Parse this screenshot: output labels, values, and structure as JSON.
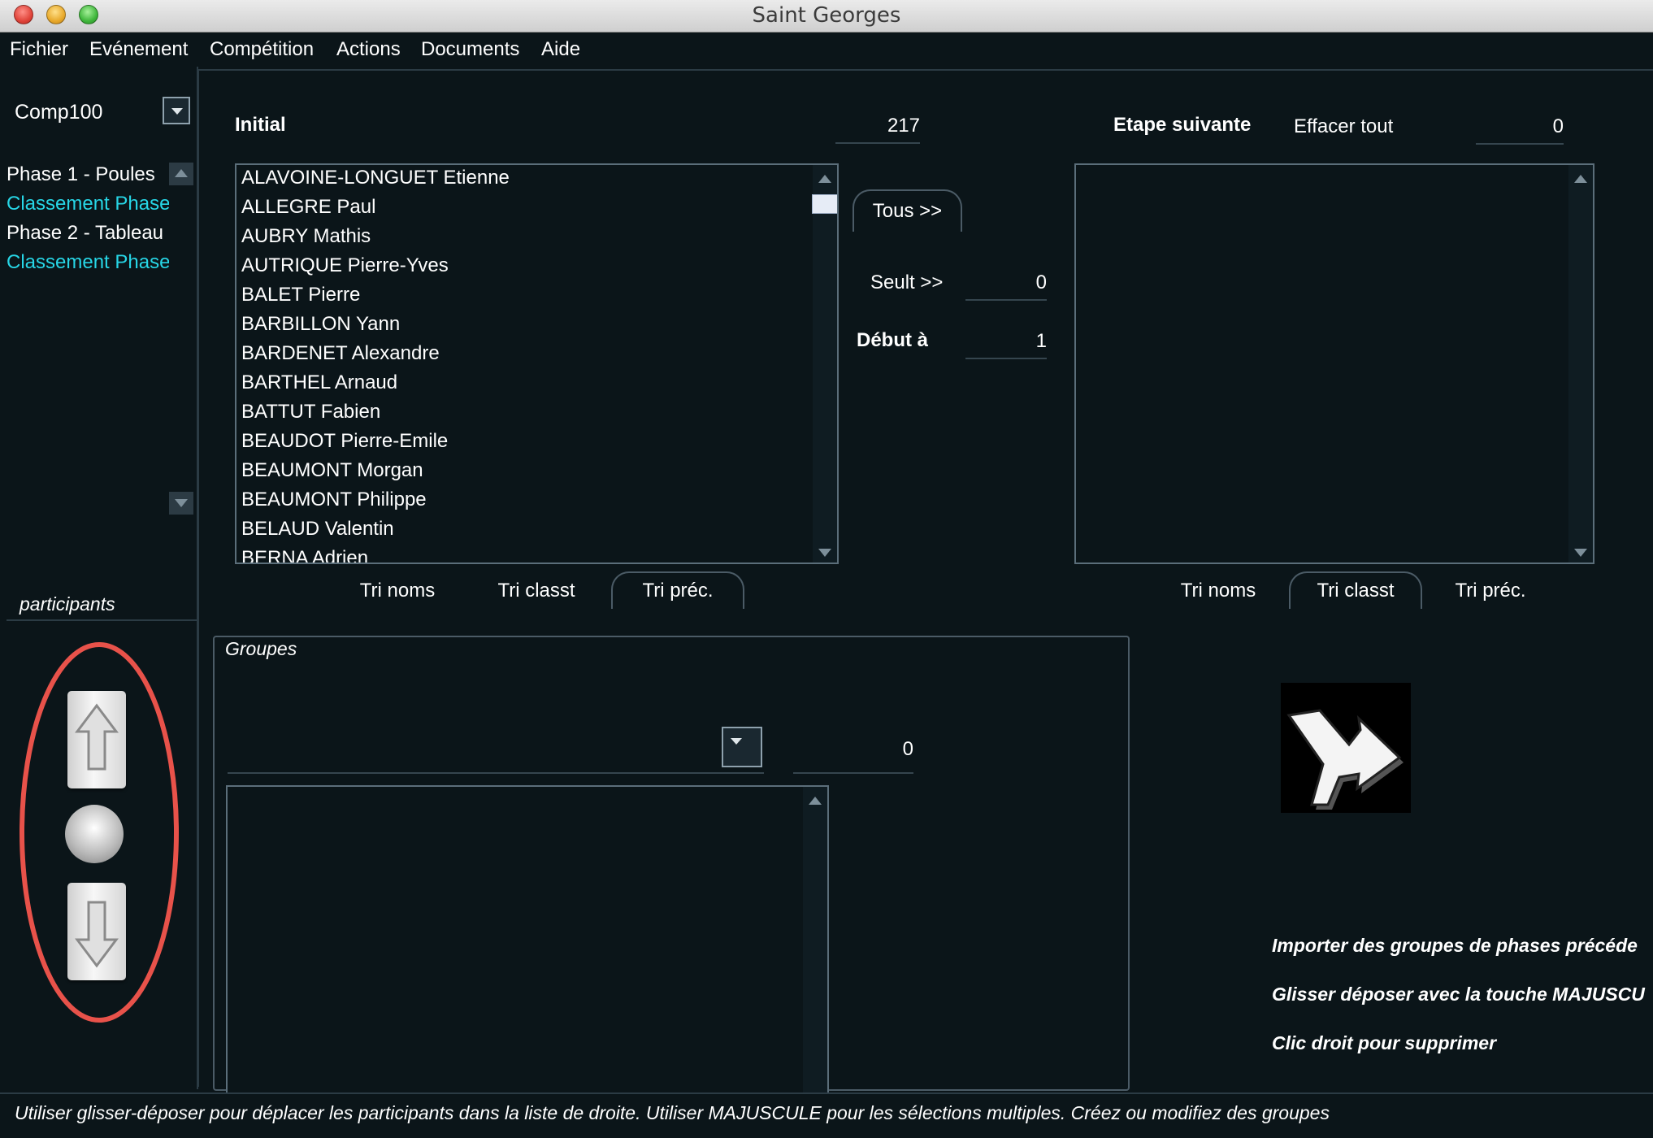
{
  "window": {
    "title": "Saint Georges"
  },
  "menu": [
    "Fichier",
    "Evénement",
    "Compétition",
    "Actions",
    "Documents",
    "Aide"
  ],
  "sidebar": {
    "competition": "Comp100",
    "phases": [
      {
        "label": "Phase 1 - Poules",
        "color": "#ffffff"
      },
      {
        "label": "Classement Phase",
        "color": "#27d6e6"
      },
      {
        "label": "Phase 2 - Tableau",
        "color": "#ffffff"
      },
      {
        "label": "Classement Phase",
        "color": "#27d6e6"
      }
    ],
    "participants_label": "participants",
    "annotation_color": "#e8524a"
  },
  "initial": {
    "label": "Initial",
    "count": "217",
    "names": [
      "ALAVOINE-LONGUET Etienne",
      "ALLEGRE Paul",
      "AUBRY Mathis",
      "AUTRIQUE Pierre-Yves",
      "BALET Pierre",
      "BARBILLON Yann",
      "BARDENET Alexandre",
      "BARTHEL Arnaud",
      "BATTUT Fabien",
      "BEAUDOT Pierre-Emile",
      "BEAUMONT Morgan",
      "BEAUMONT Philippe",
      "BELAUD Valentin",
      "BERNA Adrien"
    ],
    "sort_tabs": [
      "Tri noms",
      "Tri classt",
      "Tri préc."
    ],
    "active_tab": 2
  },
  "transfer": {
    "all_button": "Tous >>",
    "threshold_label": "Seult >>",
    "threshold_value": "0",
    "start_label": "Début à",
    "start_value": "1"
  },
  "next_stage": {
    "label": "Etape suivante",
    "clear_label": "Effacer tout",
    "count": "0",
    "sort_tabs": [
      "Tri noms",
      "Tri classt",
      "Tri préc."
    ],
    "active_tab": 1
  },
  "groups": {
    "label": "Groupes",
    "count": "0"
  },
  "hints": [
    "Importer des groupes de phases précéde",
    "Glisser déposer avec la touche MAJUSCU",
    "Clic droit pour supprimer"
  ],
  "status": "Utiliser glisser-déposer pour déplacer les participants dans la liste de droite. Utiliser MAJUSCULE pour les sélections multiples. Créez ou modifiez des groupes",
  "icons": {
    "up": "arrow-up-icon",
    "down": "arrow-down-icon",
    "knob": "knob-icon",
    "merge": "merge-arrow-icon"
  }
}
